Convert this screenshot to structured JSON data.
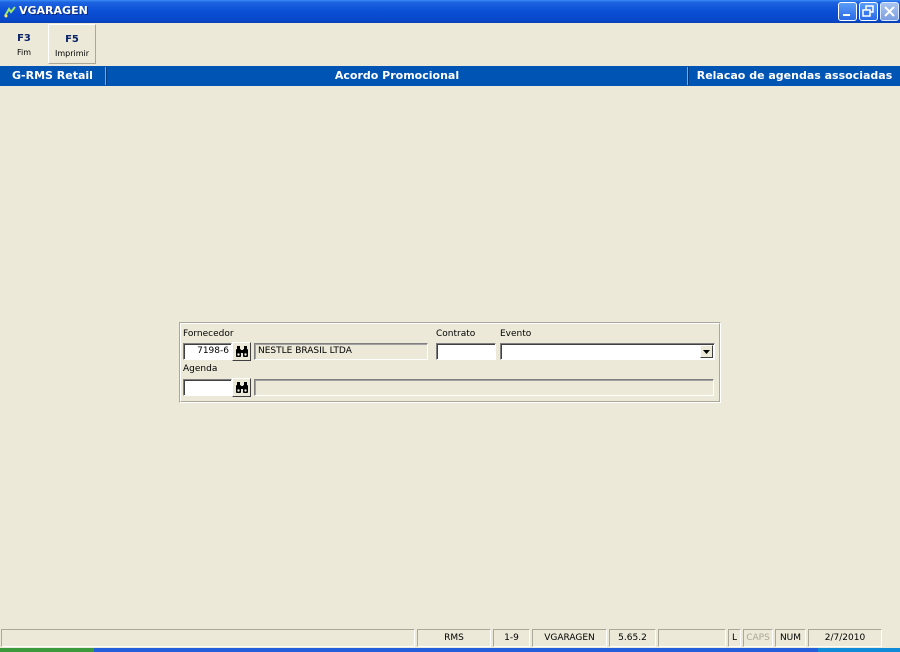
{
  "window": {
    "title": "VGARAGEN"
  },
  "toolbar": {
    "f3_key": "F3",
    "f3_label": "Fim",
    "f5_key": "F5",
    "f5_label": "Imprimir"
  },
  "header": {
    "left": "G-RMS Retail",
    "center": "Acordo Promocional",
    "right": "Relacao de agendas associadas"
  },
  "form": {
    "fornecedor_label": "Fornecedor",
    "fornecedor_code": "7198-6",
    "fornecedor_name": "NESTLE BRASIL LTDA",
    "contrato_label": "Contrato",
    "contrato_value": "",
    "evento_label": "Evento",
    "evento_value": "",
    "agenda_label": "Agenda",
    "agenda_code": "",
    "agenda_desc": ""
  },
  "statusbar": {
    "message": "",
    "system": "RMS",
    "range": "1-9",
    "program": "VGARAGEN",
    "version": "5.65.2",
    "blank": "",
    "l_indicator": "L",
    "caps": "CAPS",
    "num": "NUM",
    "date": "2/7/2010"
  },
  "icons": {
    "app": "app-icon",
    "minimize": "minimize-icon",
    "restore": "restore-icon",
    "close": "close-icon",
    "lookup": "binoculars-icon",
    "dropdown": "chevron-down-icon"
  }
}
